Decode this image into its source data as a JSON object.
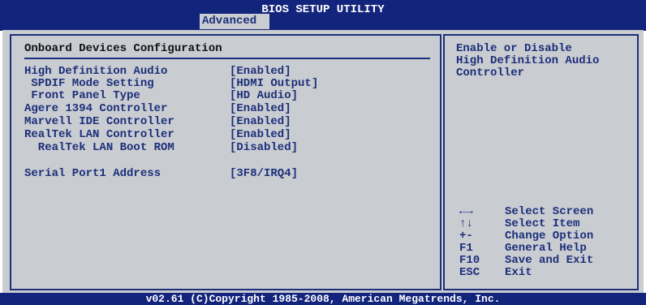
{
  "header": {
    "title": "BIOS SETUP UTILITY",
    "active_tab": "Advanced"
  },
  "section_title": "Onboard Devices Configuration",
  "settings": [
    {
      "label": "High Definition Audio",
      "value": "[Enabled]"
    },
    {
      "label": " SPDIF Mode Setting",
      "value": "[HDMI Output]"
    },
    {
      "label": " Front Panel Type",
      "value": "[HD Audio]"
    },
    {
      "label": "Agere 1394 Controller",
      "value": "[Enabled]"
    },
    {
      "label": "Marvell IDE Controller",
      "value": "[Enabled]"
    },
    {
      "label": "RealTek LAN Controller",
      "value": "[Enabled]"
    },
    {
      "label": "  RealTek LAN Boot ROM",
      "value": "[Disabled]"
    },
    {
      "label": "Serial Port1 Address",
      "value": "[3F8/IRQ4]"
    }
  ],
  "help": {
    "lines": [
      "Enable or Disable",
      "High Definition Audio",
      "Controller"
    ]
  },
  "keys": [
    {
      "key": "←→",
      "icon": "left-right-arrows-icon",
      "desc": "Select Screen"
    },
    {
      "key": "↑↓",
      "icon": "up-down-arrows-icon",
      "desc": "Select Item"
    },
    {
      "key": "+-",
      "desc": "Change Option"
    },
    {
      "key": "F1",
      "desc": "General Help"
    },
    {
      "key": "F10",
      "desc": "Save and Exit"
    },
    {
      "key": "ESC",
      "desc": "Exit"
    }
  ],
  "footer": "v02.61 (C)Copyright 1985-2008, American Megatrends, Inc.",
  "colors": {
    "bar": "#13247c",
    "panel": "#c9ccd1",
    "text": "#1c2f7a"
  }
}
